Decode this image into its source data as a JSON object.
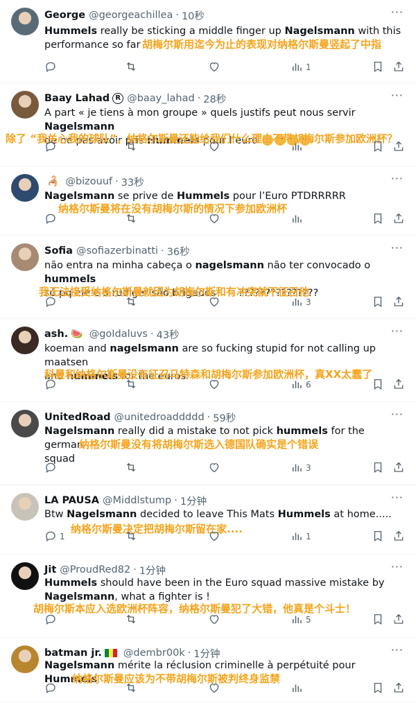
{
  "tweets": [
    {
      "name": "George",
      "handle": "@georgeachillea",
      "time": "10秒",
      "body": [
        "<b>Hummels</b> really be sticking a middle finger up <b>Nagelsmann</b> with this",
        "performance so far"
      ],
      "translation": "胡梅尔斯用迄今为止的表现对纳格尔斯曼竖起了中指",
      "replies": "",
      "retweets": "",
      "likes": "",
      "views": "1",
      "avatar_color": "#5a6b78"
    },
    {
      "name": "Baay Lahad",
      "handle": "@baay_lahad",
      "time": "28秒",
      "body": [
        "A part « je tiens à mon groupe » quels justifs peut nous servir <b>Nagelsmann</b>",
        "de ne pas avoir pris <b>Hummels</b> pour l’euro"
      ],
      "translation": "除了 “我关心我的球队”，纳格尔斯曼还能给我们什么理由不带胡梅尔斯参加欧洲杯？",
      "replies": "",
      "retweets": "",
      "likes": "",
      "views": "",
      "avatar_color": "#7a5a3c"
    },
    {
      "name": "",
      "handle": "@bizouuf",
      "time": "33秒",
      "body": [
        "<b>Nagelsmann</b> se prive de <b>Hummels</b> pour l’Euro PTDRRRRR"
      ],
      "translation": "纳格尔斯曼将在没有胡梅尔斯的情况下参加欧洲杯",
      "replies": "",
      "retweets": "",
      "likes": "",
      "views": "",
      "avatar_color": "#2e4a6e"
    },
    {
      "name": "Sofia",
      "handle": "@sofiazerbinatti",
      "time": "36秒",
      "body": [
        "não entra na minha cabeça o <b>nagelsmann</b> não ter convocado o <b>hummels</b>",
        "só pq ele e o rudiger são brigados &nbsp;&nbsp;&nbsp;&nbsp;&nbsp;&nbsp;???????????????"
      ],
      "translation": "我无法接受纳格尔斯曼就因为胡梅尔斯和有冲突就不征召他",
      "replies": "",
      "retweets": "",
      "likes": "",
      "views": "3",
      "avatar_color": "#a88a72"
    },
    {
      "name": "ash.",
      "handle": "@goIdaluvs",
      "time": "43秒",
      "body": [
        "koeman and <b>nagelsmann</b> are so fucking stupid for not calling up maatsen",
        "and <b>hummels</b> for the euros"
      ],
      "translation": "科曼和纳格尔斯曼没有征召马特森和胡梅尔斯参加欧洲杯，真XX太蠢了",
      "replies": "",
      "retweets": "",
      "likes": "",
      "views": "6",
      "avatar_color": "#3a2a24"
    },
    {
      "name": "UnitedRoad",
      "handle": "@unitedroaddddd",
      "time": "59秒",
      "body": [
        "<b>Nagelsmann</b> really did a mistake to not pick <b>hummels</b> for the german",
        "squad"
      ],
      "translation": "纳格尔斯曼没有将胡梅尔斯选入德国队确实是个错误",
      "replies": "",
      "retweets": "",
      "likes": "",
      "views": "3",
      "avatar_color": "#4a4a4a"
    },
    {
      "name": "LA PAUSA",
      "handle": "@Middlstump",
      "time": "1分钟",
      "body": [
        "Btw <b>Nagelsmann</b> decided to leave This Mats <b>Hummels</b> at home....."
      ],
      "translation": "纳格尔斯曼决定把胡梅尔斯留在家....",
      "replies": "1",
      "retweets": "",
      "likes": "",
      "views": "1",
      "avatar_color": "#c9c2b8"
    },
    {
      "name": "Jit",
      "handle": "@ProudRed82",
      "time": "1分钟",
      "body": [
        "<b>Hummels</b> should have been in the Euro squad massive mistake by",
        "<b>Nagelsmann</b>, what a fighter is !"
      ],
      "translation": "胡梅尔斯本应入选欧洲杯阵容，纳格尔斯曼犯了大错，他真是个斗士！",
      "replies": "",
      "retweets": "",
      "likes": "",
      "views": "5",
      "avatar_color": "#111111"
    },
    {
      "name": "batman jr.",
      "handle": "@dembr00k",
      "time": "1分钟",
      "body": [
        "<b>Nagelsmann</b> mérite la réclusion criminelle à perpétuité pour <b>Hummels</b>"
      ],
      "translation": "纳格尔斯曼应该为不带胡梅尔斯被判终身监禁",
      "replies": "",
      "retweets": "",
      "likes": "",
      "views": "",
      "avatar_color": "#b8862e"
    }
  ],
  "colors": {
    "translation": "#f5a41c",
    "muted": "#536471"
  },
  "icons": [
    "reply-icon",
    "retweet-icon",
    "like-icon",
    "views-icon",
    "bookmark-icon",
    "share-icon",
    "more-icon"
  ]
}
